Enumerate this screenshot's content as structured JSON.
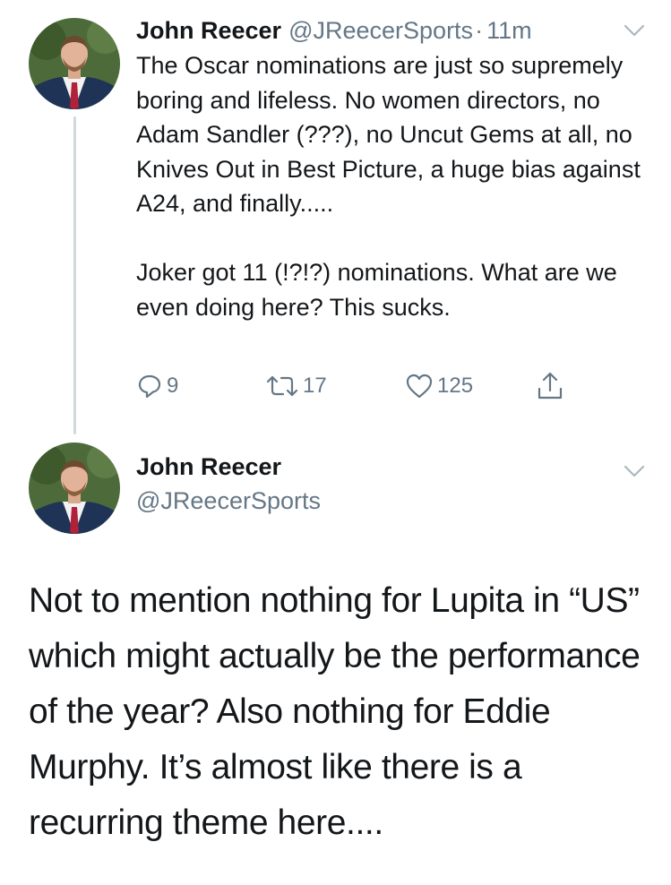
{
  "tweet1": {
    "author_name": "John Reecer",
    "handle": "@JReecerSports",
    "separator": "·",
    "time": "11m",
    "text": "The Oscar nominations are just so supremely boring and lifeless. No women directors, no Adam Sandler (???), no Uncut Gems at all, no Knives Out in Best Picture, a huge bias against A24, and finally.....\n\nJoker got 11 (!?!?) nominations. What are we even doing here? This sucks.",
    "replies": "9",
    "retweets": "17",
    "likes": "125"
  },
  "tweet2": {
    "author_name": "John Reecer",
    "handle": "@JReecerSports",
    "text": "Not to mention nothing for Lupita in “US” which might actually be the performance of the year? Also nothing for Eddie Murphy. It’s almost like there is a recurring theme here...."
  },
  "icons": {
    "reply": "reply-icon",
    "retweet": "retweet-icon",
    "like": "heart-icon",
    "share": "share-icon",
    "caret": "chevron-down-icon"
  },
  "colors": {
    "text": "#14171a",
    "secondary": "#657786",
    "thread_line": "#cfd9de"
  }
}
